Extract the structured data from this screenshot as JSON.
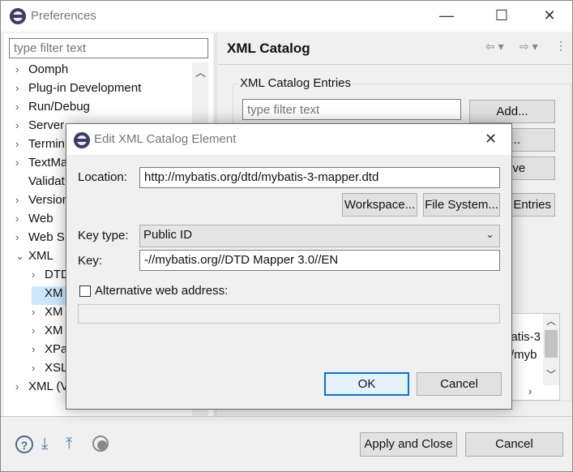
{
  "window": {
    "title": "Preferences",
    "minimize": "—",
    "maximize": "☐",
    "close": "✕"
  },
  "left": {
    "filter_placeholder": "type filter text",
    "tree": [
      {
        "label": "Oomph",
        "arrow": "›",
        "indent": 0
      },
      {
        "label": "Plug-in Development",
        "arrow": "›",
        "indent": 0
      },
      {
        "label": "Run/Debug",
        "arrow": "›",
        "indent": 0
      },
      {
        "label": "Server",
        "arrow": "›",
        "indent": 0
      },
      {
        "label": "Termin",
        "arrow": "›",
        "indent": 0
      },
      {
        "label": "TextMa",
        "arrow": "›",
        "indent": 0
      },
      {
        "label": "Validat",
        "arrow": "",
        "indent": 0
      },
      {
        "label": "Version",
        "arrow": "›",
        "indent": 0
      },
      {
        "label": "Web",
        "arrow": "›",
        "indent": 0
      },
      {
        "label": "Web S",
        "arrow": "›",
        "indent": 0
      },
      {
        "label": "XML",
        "arrow": "⌄",
        "indent": 0
      },
      {
        "label": "DTD",
        "arrow": "›",
        "indent": 1
      },
      {
        "label": "XM",
        "arrow": "",
        "indent": 1,
        "selected": true
      },
      {
        "label": "XM",
        "arrow": "›",
        "indent": 1
      },
      {
        "label": "XM",
        "arrow": "›",
        "indent": 1
      },
      {
        "label": "XPa",
        "arrow": "›",
        "indent": 1
      },
      {
        "label": "XSL",
        "arrow": "›",
        "indent": 1
      },
      {
        "label": "XML (V",
        "arrow": "›",
        "indent": 0
      }
    ]
  },
  "right": {
    "title": "XML Catalog",
    "group_label": "XML Catalog Entries",
    "filter_placeholder": "type filter text",
    "add_button": "Add...",
    "edit_button": "it...",
    "remove_button": "nove",
    "entries_button": "Entries",
    "details_line1": "batis-3",
    "details_line2": "/myb"
  },
  "footer": {
    "apply_close": "Apply and Close",
    "cancel": "Cancel"
  },
  "dialog": {
    "title": "Edit XML Catalog Element",
    "location_label": "Location:",
    "location_value": "http://mybatis.org/dtd/mybatis-3-mapper.dtd",
    "workspace_button": "Workspace...",
    "filesystem_button": "File System...",
    "keytype_label": "Key type:",
    "keytype_value": "Public ID",
    "key_label": "Key:",
    "key_value": "-//mybatis.org//DTD Mapper 3.0//EN",
    "alt_label": "Alternative web address:",
    "alt_value": "",
    "ok": "OK",
    "cancel": "Cancel"
  },
  "colors": {
    "accent": "#0078d7",
    "selection": "#cce8ff"
  }
}
